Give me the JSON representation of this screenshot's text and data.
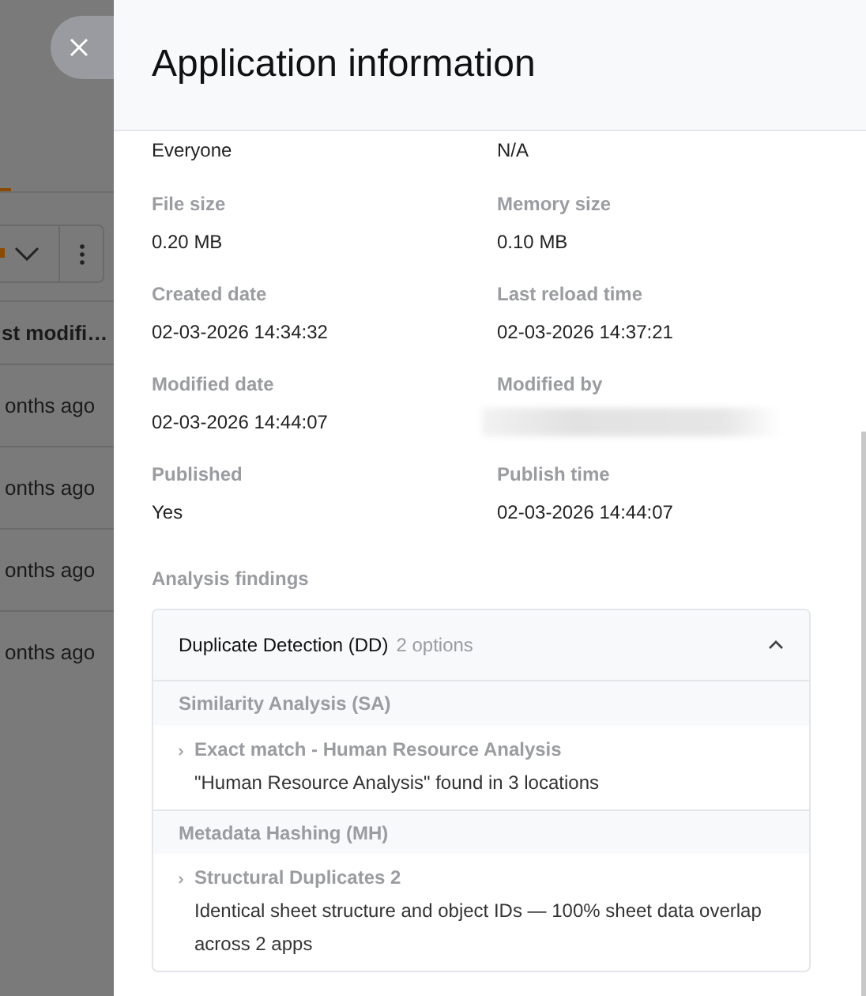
{
  "background": {
    "column_header": "st modifi…",
    "rows": [
      "onths ago",
      "onths ago",
      "onths ago",
      "onths ago"
    ]
  },
  "panel": {
    "title": "Application information",
    "fields": [
      {
        "value": "Everyone",
        "kind": "text"
      },
      {
        "value": "N/A",
        "kind": "text"
      },
      {
        "label": "File size",
        "value": "0.20 MB",
        "kind": "text"
      },
      {
        "label": "Memory size",
        "value": "0.10 MB",
        "kind": "text"
      },
      {
        "label": "Created date",
        "value": "02-03-2026 14:34:32",
        "kind": "text"
      },
      {
        "label": "Last reload time",
        "value": "02-03-2026 14:37:21",
        "kind": "text"
      },
      {
        "label": "Modified date",
        "value": "02-03-2026 14:44:07",
        "kind": "text"
      },
      {
        "label": "Modified by",
        "kind": "redacted"
      },
      {
        "label": "Published",
        "value": "Yes",
        "kind": "text"
      },
      {
        "label": "Publish time",
        "value": "02-03-2026 14:44:07",
        "kind": "text"
      }
    ],
    "findings_heading": "Analysis findings",
    "findings": {
      "title": "Duplicate Detection (DD)",
      "count": "2 options",
      "expanded": true,
      "groups": [
        {
          "name": "Similarity Analysis (SA)",
          "items": [
            {
              "title": "Exact match - Human Resource Analysis",
              "detail": "\"Human Resource Analysis\" found in 3 locations"
            }
          ]
        },
        {
          "name": "Metadata Hashing (MH)",
          "items": [
            {
              "title": "Structural Duplicates 2",
              "detail": "Identical sheet structure and object IDs — 100% sheet data overlap across 2 apps"
            }
          ]
        }
      ]
    }
  }
}
